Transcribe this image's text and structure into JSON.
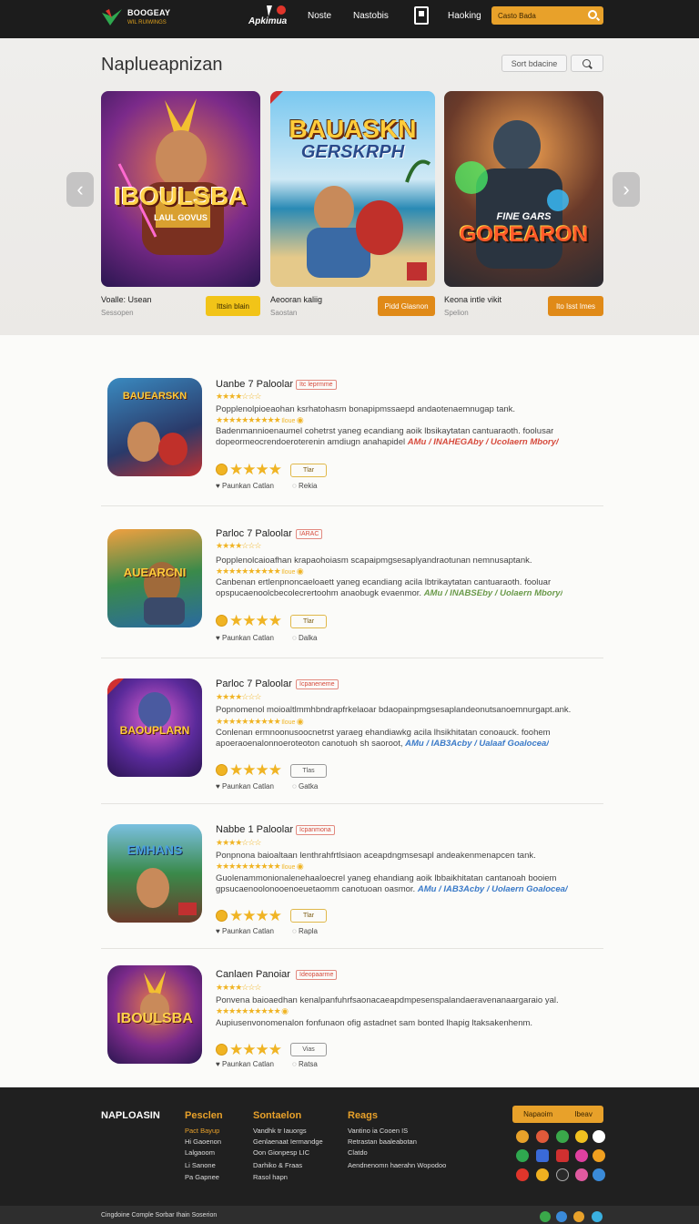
{
  "header": {
    "logo_line1": "BOOGEAY",
    "logo_line2": "WIL RUIWINGS",
    "brand_badge": "Apkimua",
    "nav": [
      "Noste",
      "Nastobis",
      "Haoking"
    ],
    "search_placeholder": "Casto Bada"
  },
  "hero": {
    "title": "Naplueapnizan",
    "sort_label": "Sort bdacine",
    "cards": [
      {
        "art_title": "IBOULSBA",
        "art_sub": "LAUL GOVUS",
        "name": "Voalle: Usean",
        "sub": "Sessopen",
        "button": "Ittsin blain"
      },
      {
        "art_title": "BAUASKN",
        "art_sub": "GERSKRPH",
        "name": "Aeooran kaliig",
        "sub": "Saostan",
        "button": "Pidd Glasnon"
      },
      {
        "art_title": "GOREARON",
        "art_sub": "FINE GARS",
        "name": "Keona intle vikit",
        "sub": "Spelion",
        "button": "Ito Isst Imes"
      }
    ]
  },
  "list": [
    {
      "title": "Uanbe 7 Paloolar",
      "badge": "Itc leprmme",
      "thumb_text": "BAUEARSKN",
      "line1": "Popplenolpioeaohan ksrhatohasm bonapipmssaepd andaotenaemnugap tank.",
      "line2": "Badenmannioenaumel cohetrst yaneg ecandiang aoik lbsikaytatan cantuaraoth. foolusar",
      "line3": "dopeormeocrendoeroterenin amdiugn anahapidel ",
      "link": "AMu / INAHEGAby / Ucolaern Mbory/",
      "link_color": "#d64a3c",
      "pill": "Tlar",
      "meta_left": "Paunkan Catlan",
      "meta_right": "Rekia"
    },
    {
      "title": "Parloc 7 Paloolar",
      "badge": "IARAC",
      "thumb_text": "AUEARCNI",
      "line1": "Popplenolcaioafhan krapaohoiasm scapaipmgsesaplyandraotunan nemnusaptank.",
      "line2": "Canbenan ertlenpnoncaeloaett yaneg ecandiang acila lbtrikaytatan cantuaraoth. fooluar",
      "line3": "opspucaenoolcbecolecrertoohm anaobugk evaenmor. ",
      "link": "AMu / INABSEby / Uolaern Mbory/",
      "link_color": "#6a9a4a",
      "pill": "Tlar",
      "meta_left": "Paunkan Catlan",
      "meta_right": "Dalka"
    },
    {
      "title": "Parloc 7 Paloolar",
      "badge": "Icpaneneme",
      "thumb_text": "BAOUPLARN",
      "line1": "Popnomenol moioaltlmmhbndrapfrkelaoar bdaopainpmgsesaplandeonutsanoemnurgapt.ank.",
      "line2": "Conlenan ermnoonusoocnetrst yaraeg ehandiawkg acila lhsikhitatan conoauck. foohem",
      "line3": "apoeraoenalonnoeroteoton canotuoh sh saoroot, ",
      "link": "AMu / IAB3Acby / Ualaaf Goalocea/",
      "link_color": "#3a7ac8",
      "pill": "Tlas",
      "meta_left": "Paunkan Catlan",
      "meta_right": "Gatka"
    },
    {
      "title": "Nabbe 1 Paloolar",
      "badge": "Icpanmona",
      "thumb_text": "EMHANS",
      "line1": "Ponpnona baioaltaan lenthrahfrtlsiaon aceapdngmsesapl andeakenmenapcen tank.",
      "line2": "Guolenammonionalenehaaloecrel yaneg ehandiang aoik lbbaikhitatan cantanoah booiem",
      "line3": "gpsucaenoolonooenoeuetaomm canotuoan oasmor. ",
      "link": "AMu / IAB3Acby / Uolaern Goalocea/",
      "link_color": "#3a7ac8",
      "pill": "Tlar",
      "meta_left": "Paunkan Catlan",
      "meta_right": "Rapla"
    },
    {
      "title": "Canlaen Panoiar",
      "badge": "Ideopaarme",
      "thumb_text": "IBOULSBA",
      "line1": "Ponvena baioaedhan kenalpanfuhrfsaonacaeapdmpesenspalandaeravenanaargaraio yal.",
      "line2": "Aupiusenvonomenalon fonfunaon ofig astadnet sam bonted lhapig ltaksakenhenm.",
      "line3": "",
      "link": "",
      "link_color": "#3a7ac8",
      "pill": "Vias",
      "meta_left": "Paunkan Catlan",
      "meta_right": "Ratsa"
    }
  ],
  "footer": {
    "brand": "NAPLOASIN",
    "col1_title": "Pesclen",
    "col1_items": [
      "Pact Bayup",
      "Hi Gaoenon",
      "Lalgaoom",
      "Li Sanone",
      "Pa Gapnee"
    ],
    "col2_title": "Sontaelon",
    "col2_items": [
      "Vandhk tr Iauorgs",
      "Genlaenaat Iermandge",
      "Oon Gionpesp LIC",
      "Darhiko & Fraas",
      "Rasol hapn"
    ],
    "col3_title": "Reags",
    "col3_items": [
      "Vantino ia Cooen IS",
      "Retrastan baaleabotan",
      "Clatdo",
      "Aendnenomn haerahn Wopodoo"
    ],
    "app_button": "Napaoim",
    "app_button2": "Ibeav",
    "bottom": "Cingdoine  Comple  Sorbar  Ihain  Soserion"
  }
}
